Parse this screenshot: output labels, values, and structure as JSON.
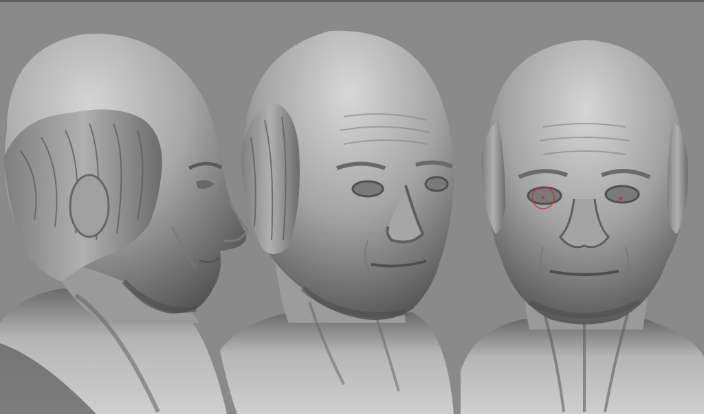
{
  "viewport": {
    "background": "#8a8a8a",
    "material": "matcap-grey",
    "views": [
      {
        "id": "side-view",
        "angle": "profile"
      },
      {
        "id": "three-quarter-view",
        "angle": "three-quarter"
      },
      {
        "id": "front-view",
        "angle": "front"
      }
    ]
  },
  "brush_cursor": {
    "color": "#d03030"
  }
}
